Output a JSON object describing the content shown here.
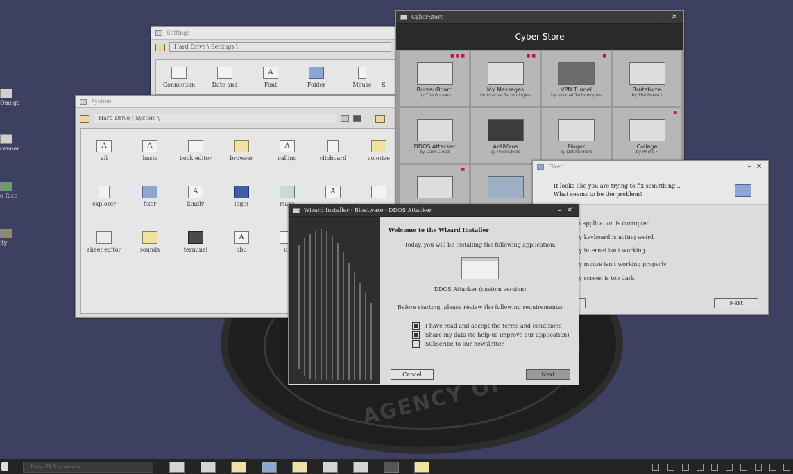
{
  "desktop": {
    "emblem_text": "AGENCY OF",
    "icons": [
      {
        "label": "Omega"
      },
      {
        "label": "canner"
      },
      {
        "label": "o Rico"
      },
      {
        "label": "ity"
      }
    ]
  },
  "settings_window": {
    "title": "Settings",
    "path": "Hard Drive \\ Settings \\",
    "items": [
      {
        "label": "Connection",
        "icon": "network-icon"
      },
      {
        "label": "Date and",
        "icon": "calendar-icon"
      },
      {
        "label": "Font",
        "icon": "font-icon"
      },
      {
        "label": "Folder",
        "icon": "folder-icon"
      },
      {
        "label": "Mouse",
        "icon": "mouse-icon"
      },
      {
        "label": "S",
        "icon": "settings-icon"
      }
    ]
  },
  "system_window": {
    "title": "System",
    "path": "Hard Drive \\ System \\",
    "items": [
      {
        "label": "afi",
        "glyph": "A"
      },
      {
        "label": "basis",
        "glyph": "A"
      },
      {
        "label": "book editor",
        "glyph": ""
      },
      {
        "label": "browser",
        "glyph": ""
      },
      {
        "label": "calling",
        "glyph": "A"
      },
      {
        "label": "clipboard",
        "glyph": ""
      },
      {
        "label": "colorize",
        "glyph": ""
      },
      {
        "label": "explorer",
        "glyph": ""
      },
      {
        "label": "fixer",
        "glyph": ""
      },
      {
        "label": "kindly",
        "glyph": "A"
      },
      {
        "label": "login",
        "glyph": ""
      },
      {
        "label": "mana",
        "glyph": ""
      },
      {
        "label": "",
        "glyph": "A"
      },
      {
        "label": "",
        "glyph": ""
      },
      {
        "label": "sheet editor",
        "glyph": ""
      },
      {
        "label": "sounds",
        "glyph": ""
      },
      {
        "label": "terminal",
        "glyph": ""
      },
      {
        "label": "ubu",
        "glyph": "A"
      },
      {
        "label": "us",
        "glyph": ""
      }
    ]
  },
  "store_window": {
    "title": "CyberStore",
    "header": "Cyber Store",
    "apps": [
      {
        "name": "BureauBoard",
        "by": "by The Bureau",
        "badge": "■ ■ ■"
      },
      {
        "name": "My Messages",
        "by": "by Internal Technologies",
        "badge": "■ ■"
      },
      {
        "name": "VPN Tunnel",
        "by": "by Internal Technologies",
        "badge": "■"
      },
      {
        "name": "Bruteforce",
        "by": "by The Bureau",
        "badge": ""
      },
      {
        "name": "DDOS Attacker",
        "by": "by Dark Cloud",
        "badge": ""
      },
      {
        "name": "AntiVirus",
        "by": "by Mech&Field",
        "badge": ""
      },
      {
        "name": "Pinger",
        "by": "by Net Runners",
        "badge": ""
      },
      {
        "name": "Collage",
        "by": "by Photo F",
        "badge": "■"
      },
      {
        "name": "",
        "by": "",
        "badge": "■"
      },
      {
        "name": "",
        "by": "",
        "badge": ""
      }
    ]
  },
  "fixer_window": {
    "title": "Fixer",
    "question_line1": "It looks like you are trying to fix something...",
    "question_line2": "What seems to be the problem?",
    "options": [
      "n application is corrupted",
      "ly keyboard is acting weird",
      "ly internet isn't working",
      "ly mouse isn't working properly",
      "ly screen is too dark"
    ],
    "next_label": "Next"
  },
  "wizard_window": {
    "title": "Wizard Installer - Bloatware - DDOS Attacker",
    "heading": "Welcome to the Wizard Installer",
    "intro": "Today, you will be installing the following application:",
    "app_name": "DDOS Attacker (custom version)",
    "requirements": "Before starting, please review the following requirements:",
    "checkboxes": [
      {
        "label": "I have read and accept the terms and conditions",
        "checked": true
      },
      {
        "label": "Share my data (to help us improve our application)",
        "checked": true
      },
      {
        "label": "Subscribe to our newsletter",
        "checked": false
      }
    ],
    "cancel_label": "Cancel",
    "next_label": "Next"
  },
  "taskbar": {
    "search_placeholder": "Press TAB to search"
  }
}
